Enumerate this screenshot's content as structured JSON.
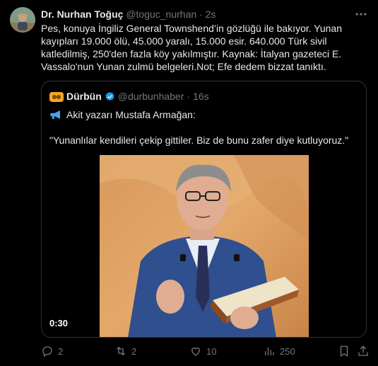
{
  "tweet": {
    "author_name": "Dr. Nurhan Toğuç",
    "author_handle": "@toguc_nurhan",
    "separator": "·",
    "time": "2s",
    "text_lines": [
      "Pes, konuya İngiliz General Townshend’in gözlüğü ile bakıyor. Yunan",
      "kayıpları 19.000 ölü, 45.000 yaralı, 15.000 esir. 640.000 Türk sivil",
      "katledilmiş,  250'den fazla köy yakılmıştır. Kaynak: İtalyan gazeteci E.",
      "Vassalo'nun Yunan zulmü belgeleri.Not; Efe dedem bizzat tanıktı."
    ]
  },
  "quote": {
    "author_name": "Dürbün",
    "author_handle": "@durbunhaber",
    "separator": "·",
    "time": "16s",
    "line1": "Akit yazarı Mustafa Armağan:",
    "line2": "\"Yunanlılar kendileri çekip gittiler. Biz de bunu zafer diye kutluyoruz.\"",
    "video_duration": "0:30"
  },
  "actions": {
    "replies": "2",
    "reposts": "2",
    "likes": "10",
    "views": "250"
  },
  "icons": {
    "more": "more-icon",
    "reply": "reply-icon",
    "repost": "repost-icon",
    "like": "heart-icon",
    "views": "views-icon",
    "bookmark": "bookmark-icon",
    "share": "share-icon",
    "verified": "verified-badge-icon",
    "megaphone": "megaphone-icon"
  },
  "colors": {
    "background": "#000000",
    "text": "#e7e9ea",
    "secondary": "#71767b",
    "verified": "#1d9bf0",
    "border": "#2f3336"
  }
}
